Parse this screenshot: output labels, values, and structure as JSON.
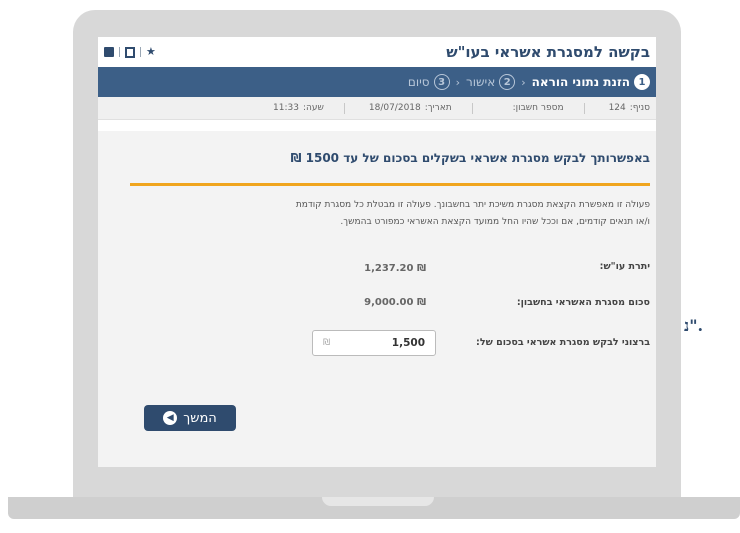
{
  "page": {
    "title": "בקשה למסגרת אשראי בעו\"ש",
    "side_text": "נ\"."
  },
  "toolbar": {
    "icons": [
      "print-icon",
      "save-icon",
      "star-icon"
    ]
  },
  "steps": [
    {
      "num": "1",
      "label": "הזנת נתוני הוראה",
      "state": "active"
    },
    {
      "num": "2",
      "label": "אישור",
      "state": "inactive"
    },
    {
      "num": "3",
      "label": "סיום",
      "state": "inactive"
    }
  ],
  "info": {
    "branch_label": "סניף:",
    "branch_value": "124",
    "account_label": "מספר חשבון:",
    "date_label": "תאריך:",
    "date_value": "18/07/2018",
    "time_label": "שעה:",
    "time_value": "11:33"
  },
  "main": {
    "heading": "באפשרותך לבקש מסגרת אשראי בשקלים בסכום של עד 1500 ₪",
    "desc_line1": "פעולה זו מאפשרת הקצאת מסגרת משיכת יתר בחשבונך. פעולה זו מבטלת כל מסגרת קודמת",
    "desc_line2": "ו/או תנאים קודמים, אם וככל שהיו החל ממועד הקצאת האשראי כמפורט בהמשך.",
    "balance_label": "יתרת עו\"ש:",
    "balance_value": "₪ 1,237.20",
    "credit_label": "סכום מסגרת האשראי בחשבון:",
    "credit_value": "₪ 9,000.00",
    "request_label": "ברצוני לבקש מסגרת אשראי בסכום של:",
    "request_currency": "₪",
    "request_value": "1,500",
    "continue_label": "המשך"
  },
  "colors": {
    "primary": "#3c5f87",
    "title": "#2f4b6e",
    "accent": "#f0a51e"
  }
}
